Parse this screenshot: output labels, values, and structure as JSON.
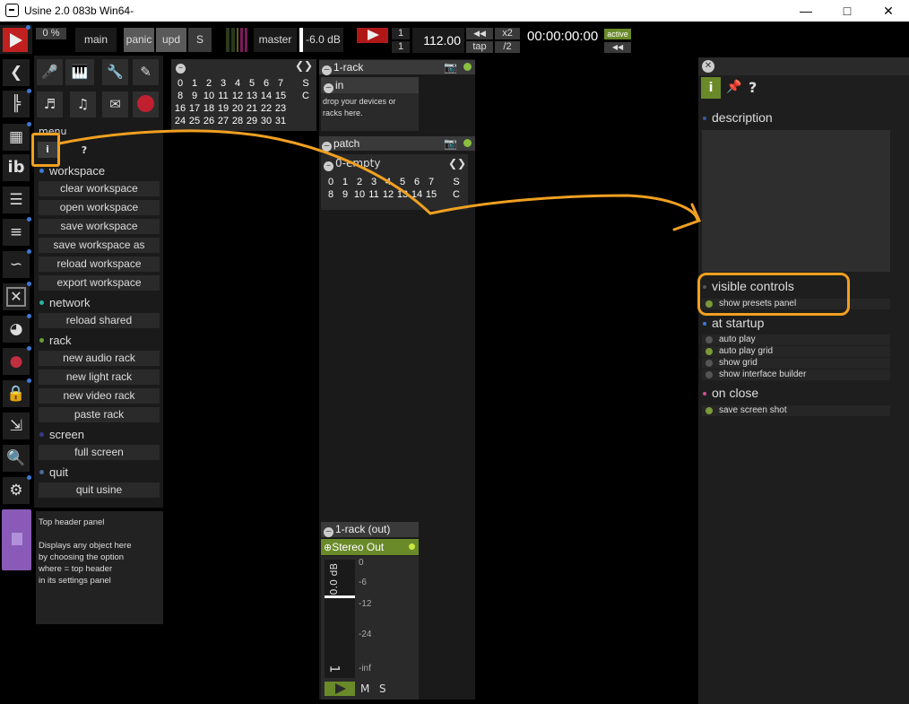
{
  "window": {
    "title": "Usine 2.0 083b Win64-"
  },
  "toolbar": {
    "cpu": "0 %",
    "main": "main",
    "panic": "panic",
    "upd": "upd",
    "s": "S",
    "master": "master",
    "db": "-6.0 dB",
    "sig_top": "1",
    "sig_bot": "1",
    "tempo": "112.00",
    "x2": "x2",
    "tap": "tap",
    "div2": "/2",
    "time": "00:00:00:00",
    "active": "active"
  },
  "menu": {
    "title": "menu",
    "info_tab": "i",
    "help_tab": "?",
    "sections": [
      {
        "label": "workspace",
        "color": "#3a7ad8",
        "items": [
          "clear workspace",
          "open workspace",
          "save workspace",
          "save workspace as",
          "reload workspace",
          "export workspace"
        ]
      },
      {
        "label": "network",
        "color": "#2ab0a0",
        "items": [
          "reload shared"
        ]
      },
      {
        "label": "rack",
        "color": "#6aa030",
        "items": [
          "new audio rack",
          "new light rack",
          "new video rack",
          "paste rack"
        ]
      },
      {
        "label": "screen",
        "color": "#3a3a8a",
        "items": [
          "full screen"
        ]
      },
      {
        "label": "quit",
        "color": "#4a6a9a",
        "items": [
          "quit usine"
        ]
      }
    ],
    "help_text": [
      "Top header panel",
      "",
      "Displays any object here",
      "by choosing the option",
      "where = top header",
      "in its settings panel"
    ]
  },
  "grid": {
    "rows": [
      [
        "0",
        "1",
        "2",
        "3",
        "4",
        "5",
        "6",
        "7",
        "S"
      ],
      [
        "8",
        "9",
        "10",
        "11",
        "12",
        "13",
        "14",
        "15",
        "C"
      ],
      [
        "16",
        "17",
        "18",
        "19",
        "20",
        "21",
        "22",
        "23"
      ],
      [
        "24",
        "25",
        "26",
        "27",
        "28",
        "29",
        "30",
        "31"
      ]
    ]
  },
  "rack": {
    "title": "1-rack",
    "in_title": "in",
    "in_text": [
      "drop your devices or",
      "racks here."
    ],
    "patch_title": "patch",
    "empty": "0-empty",
    "patch_rows": [
      [
        "0",
        "1",
        "2",
        "3",
        "4",
        "5",
        "6",
        "7",
        "S"
      ],
      [
        "8",
        "9",
        "10",
        "11",
        "12",
        "13",
        "14",
        "15",
        "C"
      ]
    ]
  },
  "out": {
    "title": "1-rack (out)",
    "stereo": "Stereo Out",
    "db": "0.0 dB",
    "scale": [
      "0",
      "-6",
      "-12",
      "-24",
      "-inf"
    ],
    "ch": "1",
    "m": "M",
    "s": "S"
  },
  "inspector": {
    "tabs": [
      "i",
      "pin",
      "?"
    ],
    "description": "description",
    "visible_controls": "visible controls",
    "show_presets": "show presets panel",
    "at_startup": "at startup",
    "startup_items": [
      {
        "label": "auto play",
        "on": false
      },
      {
        "label": "auto play grid",
        "on": true
      },
      {
        "label": "show grid",
        "on": false
      },
      {
        "label": "show interface builder",
        "on": false
      }
    ],
    "on_close": "on close",
    "close_items": [
      {
        "label": "save screen shot",
        "on": true
      }
    ]
  }
}
